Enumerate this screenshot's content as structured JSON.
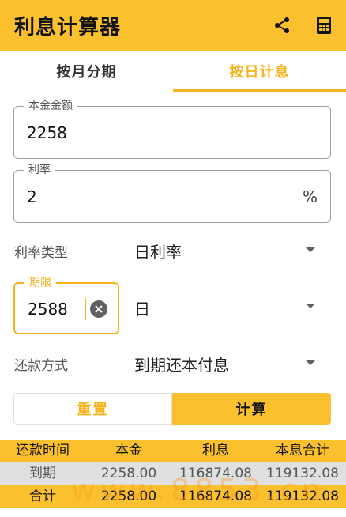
{
  "app": {
    "title": "利息计算器",
    "accent_color": "#FBC02D",
    "active_color": "#F5B41E"
  },
  "toolbar": {
    "share_icon": "share-icon",
    "calculator_icon": "calculator-icon"
  },
  "tabs": [
    {
      "label": "按月分期",
      "active": false
    },
    {
      "label": "按日计息",
      "active": true
    }
  ],
  "form": {
    "principal": {
      "label": "本金金额",
      "value": "2258"
    },
    "rate": {
      "label": "利率",
      "value": "2",
      "suffix": "%"
    },
    "rate_type": {
      "label": "利率类型",
      "value": "日利率"
    },
    "term": {
      "label": "期限",
      "value": "2588",
      "unit": "日"
    },
    "repayment": {
      "label": "还款方式",
      "value": "到期还本付息"
    }
  },
  "buttons": {
    "reset": "重置",
    "calculate": "计算"
  },
  "table": {
    "headers": [
      "还款时间",
      "本金",
      "利息",
      "本息合计"
    ],
    "rows": [
      [
        "到期",
        "2258.00",
        "116874.08",
        "119132.08"
      ]
    ],
    "total": [
      "合计",
      "2258.00",
      "116874.08",
      "119132.08"
    ]
  },
  "watermark": "www.8853.cn"
}
